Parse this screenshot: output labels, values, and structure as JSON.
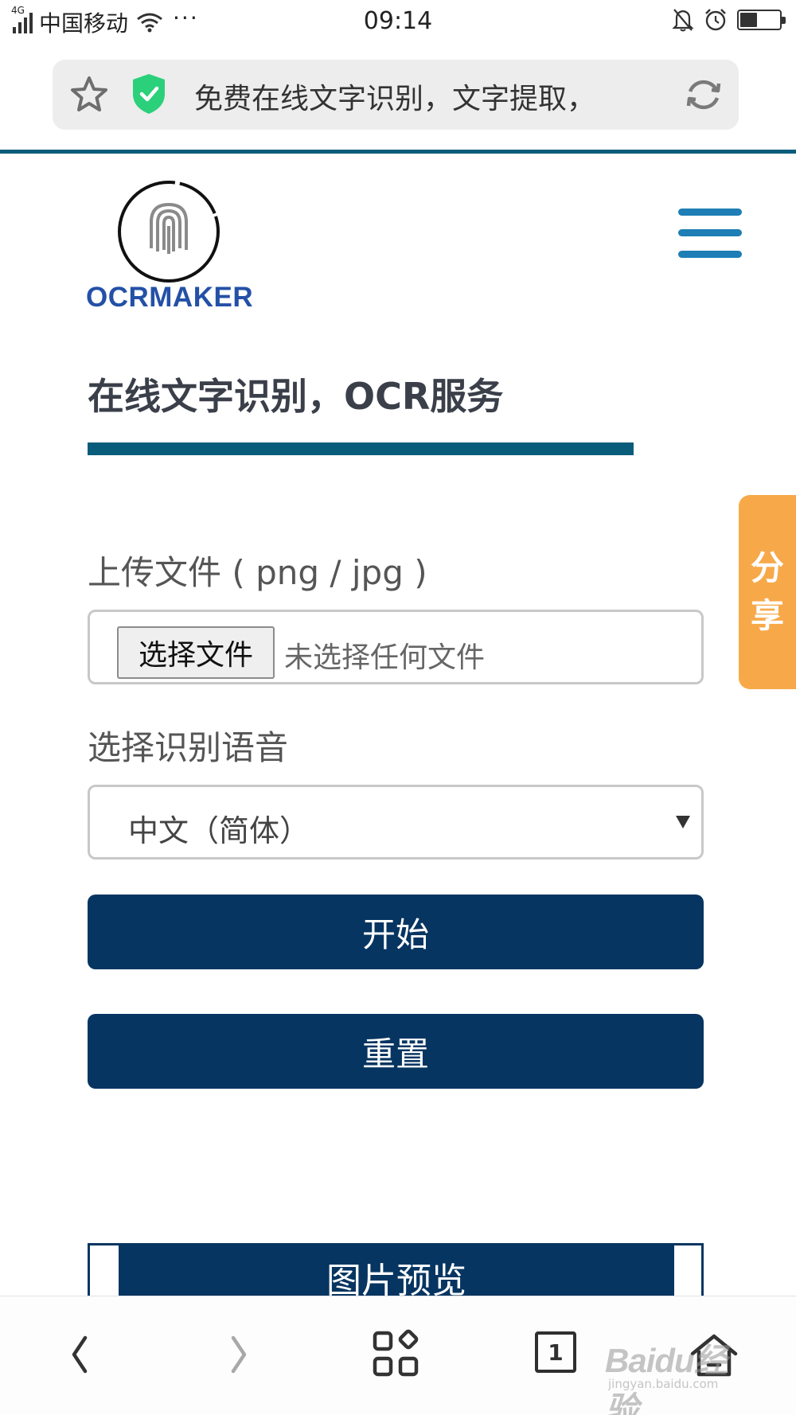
{
  "status_bar": {
    "network": "4G",
    "carrier": "中国移动",
    "dots": "···",
    "time": "09:14",
    "battery_level": 0.4
  },
  "address_bar": {
    "title": "免费在线文字识别，文字提取，..."
  },
  "site": {
    "logo_text": "OCRMAKER",
    "title": "在线文字识别，OCR服务"
  },
  "share_tab": {
    "chars": [
      "分",
      "享"
    ]
  },
  "form": {
    "upload_label": "上传文件 ( png / jpg )",
    "choose_file_label": "选择文件",
    "no_file_text": "未选择任何文件",
    "language_label": "选择识别语音",
    "language_value": "中文（简体）",
    "start_label": "开始",
    "reset_label": "重置",
    "preview_label": "图片预览"
  },
  "bottom_nav": {
    "back": "〈",
    "forward": "〉",
    "tab_count": "1"
  },
  "watermark": {
    "logo": "Baidu经验",
    "sub": "jingyan.baidu.com"
  },
  "colors": {
    "navy": "#073561",
    "teal_rule": "#0a5c7b",
    "menu_blue": "#1e7eb5",
    "logo_blue": "#2450a7",
    "share_orange": "#f7a94a",
    "shield_green": "#2bd07a"
  }
}
